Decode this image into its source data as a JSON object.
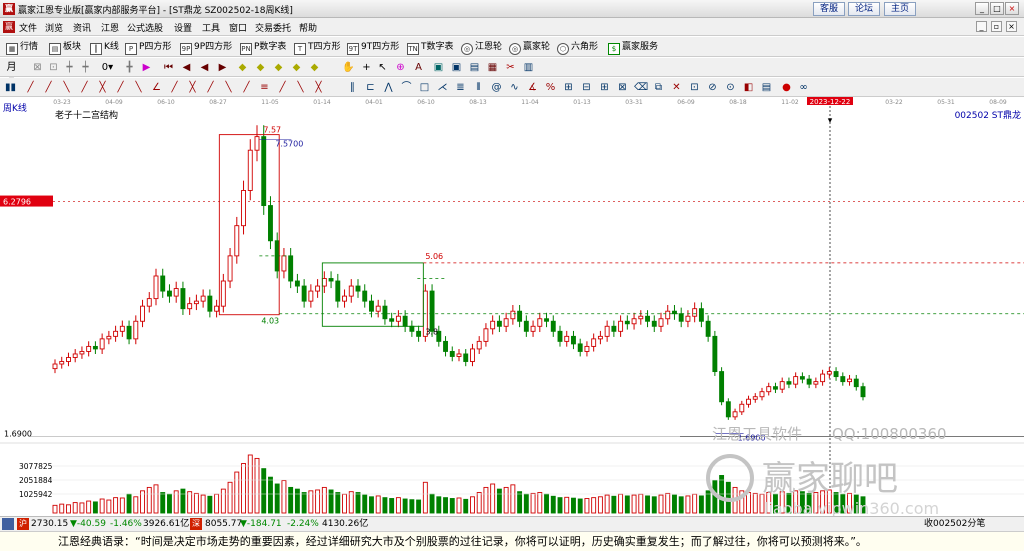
{
  "window": {
    "title": "赢家江恩专业版[赢家内部服务平台] - [ST鼎龙  SZ002502-18周K线]",
    "links": [
      "客服",
      "论坛",
      "主页"
    ],
    "controls": [
      "_",
      "□",
      "×"
    ]
  },
  "menu": {
    "items": [
      "文件",
      "浏览",
      "资讯",
      "江恩",
      "公式选股",
      "设置",
      "工具",
      "窗口",
      "交易委托",
      "帮助"
    ]
  },
  "toolbar": {
    "buttons": [
      {
        "label": "行情",
        "icon": "grid-icon"
      },
      {
        "label": "板块",
        "icon": "blocks-icon"
      },
      {
        "label": "K线",
        "icon": "kline-icon"
      },
      {
        "label": "P四方形",
        "icon": "P"
      },
      {
        "label": "9P四方形",
        "icon": "9P"
      },
      {
        "label": "P数字表",
        "icon": "PN"
      },
      {
        "label": "T四方形",
        "icon": "T"
      },
      {
        "label": "9T四方形",
        "icon": "9T"
      },
      {
        "label": "T数字表",
        "icon": "TN"
      },
      {
        "label": "江恩轮",
        "icon": "wheel-icon"
      },
      {
        "label": "赢家轮",
        "icon": "wheel-icon"
      },
      {
        "label": "六角形",
        "icon": "hexagon-icon"
      },
      {
        "label": "赢家服务",
        "icon": "dollar-icon"
      }
    ]
  },
  "chart": {
    "period_label": "周K线",
    "study_label": "老子十二宫结构",
    "stock_label": "002502  ST鼎龙",
    "price_marker": "6.2796",
    "date_marker": "2023-12-22",
    "x_ticks": [
      "03-23",
      "04-09",
      "06-10",
      "08-27",
      "11-05",
      "01-14",
      "04-01",
      "06-10",
      "08-13",
      "11-04",
      "01-13",
      "03-31",
      "06-09",
      "08-18",
      "11-02",
      "01-09",
      "03-22",
      "05-31",
      "08-09"
    ],
    "annotations": {
      "high": "7.57",
      "high2": "7.5700",
      "low_box1": "4.03",
      "box2_top": "5.06",
      "box2_low": "3.8",
      "low": "1.6900",
      "price_axis_low": "1.6900"
    },
    "volume_ticks": [
      "3077825",
      "2051884",
      "1025942"
    ],
    "watermark": {
      "line1": "江恩工具软件",
      "line2": "QQ:100800360",
      "line3": "赢家聊吧",
      "line4": "liaoba.vipwin360.com"
    }
  },
  "status": {
    "sh": {
      "icon": "沪",
      "value": "2730.15",
      "change": "▼-40.59",
      "pct": "-1.46%",
      "amount": "3926.61亿"
    },
    "sz": {
      "icon": "深",
      "value": "8055.77",
      "change": "▼-184.71",
      "pct": "-2.24%",
      "amount": "4130.26亿"
    },
    "right": "收002502分笔"
  },
  "quote": "江恩经典语录：“时间是决定市场走势的重要因素，经过详细研究大市及个别股票的过往记录，你将可以证明，历史确实重复发生；而了解过往，你将可以预测将来。”。",
  "chart_data": {
    "type": "candlestick",
    "period": "weekly",
    "price_axis_labels": [
      "6.2796",
      "1.6900"
    ],
    "key_levels": {
      "high": 7.57,
      "low": 1.69,
      "box1_bottom": 4.03,
      "box2_top": 5.06,
      "box2_bottom": 3.8,
      "marker_price": 6.2796
    },
    "volume_axis_labels": [
      3077825,
      2051884,
      1025942
    ],
    "closes": [
      3.05,
      3.1,
      3.18,
      3.25,
      3.3,
      3.4,
      3.35,
      3.55,
      3.6,
      3.7,
      3.8,
      3.55,
      3.9,
      4.2,
      4.35,
      4.8,
      4.5,
      4.4,
      4.55,
      4.15,
      4.25,
      4.3,
      4.4,
      4.1,
      4.2,
      4.7,
      5.2,
      5.8,
      6.5,
      7.3,
      7.57,
      6.2,
      5.5,
      4.9,
      5.2,
      4.7,
      4.6,
      4.3,
      4.5,
      4.6,
      4.75,
      4.7,
      4.3,
      4.4,
      4.6,
      4.5,
      4.3,
      4.1,
      4.2,
      3.95,
      3.9,
      4.0,
      3.8,
      3.7,
      3.6,
      4.5,
      3.7,
      3.5,
      3.3,
      3.2,
      3.25,
      3.1,
      3.35,
      3.5,
      3.75,
      3.9,
      3.8,
      3.95,
      4.1,
      3.9,
      3.7,
      3.8,
      3.95,
      3.9,
      3.7,
      3.5,
      3.6,
      3.45,
      3.3,
      3.4,
      3.55,
      3.6,
      3.8,
      3.7,
      3.9,
      3.85,
      3.95,
      4.0,
      3.9,
      3.8,
      3.95,
      4.1,
      4.05,
      3.9,
      4.0,
      4.15,
      3.9,
      3.6,
      2.9,
      2.3,
      2.0,
      2.1,
      2.25,
      2.35,
      2.4,
      2.5,
      2.6,
      2.55,
      2.7,
      2.65,
      2.8,
      2.75,
      2.65,
      2.7,
      2.85,
      2.9,
      2.8,
      2.7,
      2.75,
      2.6,
      2.4
    ],
    "volumes": [
      450,
      520,
      480,
      610,
      590,
      700,
      650,
      820,
      760,
      900,
      880,
      1100,
      950,
      1300,
      1500,
      1650,
      1200,
      1100,
      1300,
      1400,
      1250,
      1150,
      1050,
      980,
      1100,
      1400,
      1800,
      2400,
      2900,
      3400,
      3200,
      2600,
      2100,
      1700,
      1900,
      1500,
      1400,
      1200,
      1300,
      1350,
      1500,
      1350,
      1200,
      1100,
      1250,
      1200,
      1050,
      950,
      1000,
      900,
      850,
      900,
      820,
      780,
      760,
      1800,
      1100,
      950,
      900,
      850,
      880,
      800,
      950,
      1200,
      1500,
      1700,
      1400,
      1500,
      1650,
      1250,
      1100,
      1150,
      1200,
      1100,
      980,
      900,
      920,
      870,
      820,
      850,
      900,
      950,
      1050,
      980,
      1100,
      1000,
      1050,
      1100,
      1000,
      950,
      1050,
      1150,
      1050,
      950,
      1000,
      1100,
      1000,
      1300,
      1900,
      2200,
      1800,
      1500,
      1300,
      1200,
      1150,
      1100,
      1200,
      1100,
      1250,
      1150,
      1300,
      1250,
      1150,
      1200,
      1300,
      1350,
      1200,
      1100,
      1150,
      1050,
      950
    ]
  }
}
